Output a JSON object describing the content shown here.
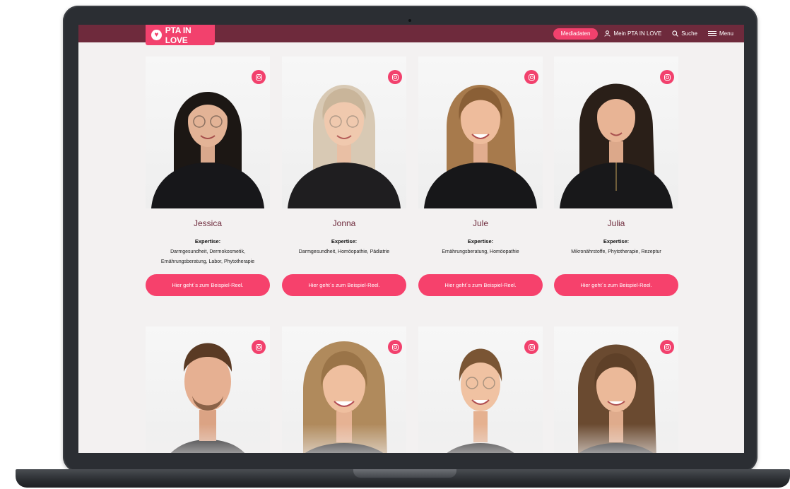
{
  "header": {
    "logo_text": "PTA IN LOVE",
    "nav": {
      "mediadaten": "Mediadaten",
      "account": "Mein PTA IN LOVE",
      "search": "Suche",
      "menu": "Menu"
    }
  },
  "expertise_label": "Expertise:",
  "reel_label": "Hier geht´s zum Beispiel-Reel.",
  "people_row1": [
    {
      "name": "Jessica",
      "expertise": "Darmgesundheit, Dermokosmetik, Ernährungsberatung, Labor, Phytotherapie"
    },
    {
      "name": "Jonna",
      "expertise": "Darmgesundheit, Homöopathie, Pädiatrie"
    },
    {
      "name": "Jule",
      "expertise": "Ernährungsberatung, Homöopathie"
    },
    {
      "name": "Julia",
      "expertise": "Mikronährstoffe, Phytotherapie, Rezeptur"
    }
  ],
  "colors": {
    "topbar": "#6e2a3c",
    "accent_pink": "#f2416d",
    "name_text": "#6e2a3c",
    "page_bg": "#f3f1f1",
    "laptop_frame": "#2b2e33"
  },
  "icons": [
    "heart-icon",
    "user-icon",
    "search-icon",
    "menu-icon",
    "instagram-icon"
  ]
}
